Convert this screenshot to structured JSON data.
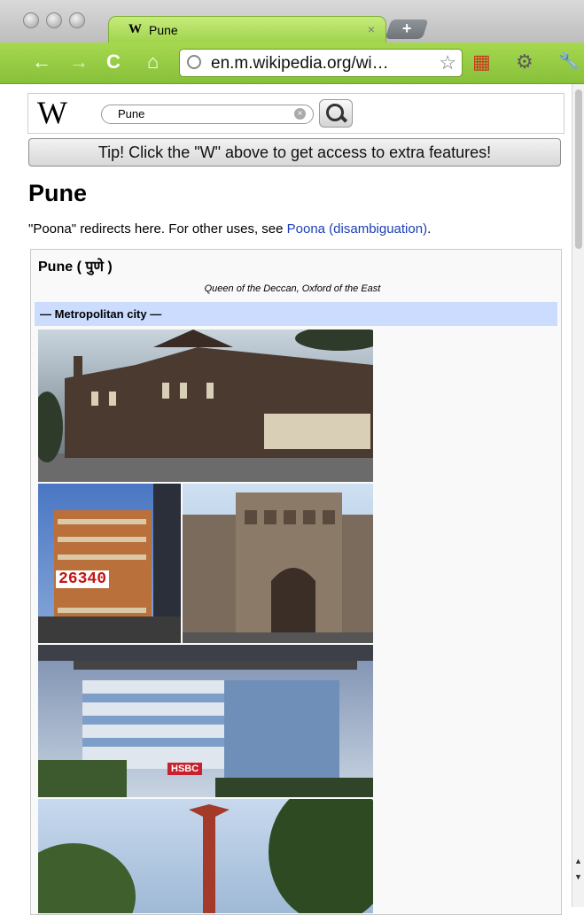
{
  "browser": {
    "tab_title": "Pune",
    "tab_favicon": "W",
    "tab_close": "×",
    "new_tab": "+",
    "url": "en.m.wikipedia.org/wi…",
    "icons": {
      "back": "←",
      "forward": "→",
      "reload": "C",
      "home": "⌂",
      "bookmark": "☆",
      "calendar": "▦",
      "settings": "⚙",
      "wrench": "🔧"
    }
  },
  "header": {
    "logo": "W",
    "search_value": "Pune",
    "clear": "×"
  },
  "tip": "Tip! Click the \"W\" above to get access to extra features!",
  "article": {
    "title": "Pune",
    "redirect_prefix": "\"Poona\" redirects here. For other uses, see ",
    "redirect_link": "Poona (disambiguation)",
    "redirect_suffix": "."
  },
  "infobox": {
    "name": "Pune ( पुणे )",
    "nickname": "Queen of the Deccan, Oxford of the East",
    "type": "— Metropolitan city —",
    "photo_texts": {
      "sign": "26340",
      "bank": "HSBC"
    }
  },
  "colors": {
    "toolbar_green": "#9fd34a",
    "link": "#1c3fb5",
    "infobox_header": "#ccdcff"
  }
}
